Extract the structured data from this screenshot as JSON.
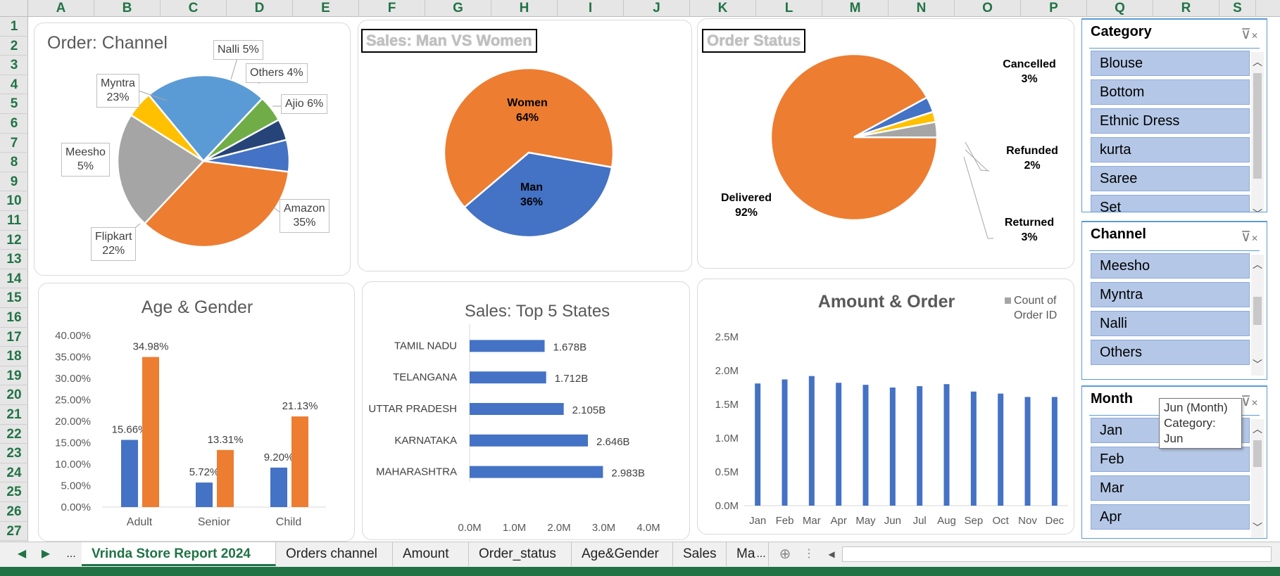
{
  "columns": [
    "A",
    "B",
    "C",
    "D",
    "E",
    "F",
    "G",
    "H",
    "I",
    "J",
    "K",
    "L",
    "M",
    "N",
    "O",
    "P",
    "Q",
    "R",
    "S"
  ],
  "rows": [
    "1",
    "2",
    "3",
    "4",
    "5",
    "6",
    "7",
    "8",
    "9",
    "10",
    "11",
    "12",
    "13",
    "14",
    "15",
    "16",
    "17",
    "18",
    "19",
    "20",
    "21",
    "22",
    "23",
    "24",
    "25",
    "26",
    "27"
  ],
  "colors": {
    "blue": "#4472c4",
    "orange": "#ed7d31",
    "gray": "#a5a5a5",
    "yellow": "#ffc000",
    "lightblue": "#5b9bd5",
    "green": "#70ad47",
    "navy": "#264478",
    "excel_green": "#217346"
  },
  "charts": {
    "order_channel": {
      "title": "Order: Channel",
      "chart_data": {
        "type": "pie",
        "slices": [
          {
            "name": "Amazon",
            "value": 35,
            "label": "35%",
            "color": "#ed7d31"
          },
          {
            "name": "Flipkart",
            "value": 22,
            "label": "22%",
            "color": "#a5a5a5"
          },
          {
            "name": "Meesho",
            "value": 5,
            "label": "5%",
            "color": "#ffc000"
          },
          {
            "name": "Myntra",
            "value": 23,
            "label": "23%",
            "color": "#5b9bd5"
          },
          {
            "name": "Nalli",
            "value": 5,
            "label": "5%",
            "color": "#70ad47"
          },
          {
            "name": "Others",
            "value": 4,
            "label": "4%",
            "color": "#264478"
          },
          {
            "name": "Ajio",
            "value": 6,
            "label": "6%",
            "color": "#4472c4"
          }
        ]
      },
      "labels": {
        "nalli": "Nalli 5%",
        "others": "Others 4%",
        "ajio": "Ajio 6%",
        "myntra_name": "Myntra",
        "myntra_pct": "23%",
        "meesho_name": "Meesho",
        "meesho_pct": "5%",
        "flipkart_name": "Flipkart",
        "flipkart_pct": "22%",
        "amazon_name": "Amazon",
        "amazon_pct": "35%"
      }
    },
    "man_women": {
      "title": "Sales: Man VS Women",
      "chart_data": {
        "type": "pie",
        "slices": [
          {
            "name": "Women",
            "value": 64,
            "label": "64%",
            "color": "#ed7d31"
          },
          {
            "name": "Man",
            "value": 36,
            "label": "36%",
            "color": "#4472c4"
          }
        ]
      },
      "labels": {
        "women_name": "Women",
        "women_pct": "64%",
        "man_name": "Man",
        "man_pct": "36%"
      }
    },
    "order_status": {
      "title": "Order Status",
      "chart_data": {
        "type": "pie",
        "slices": [
          {
            "name": "Delivered",
            "value": 92,
            "label": "92%",
            "color": "#ed7d31"
          },
          {
            "name": "Returned",
            "value": 3,
            "label": "3%",
            "color": "#4472c4"
          },
          {
            "name": "Refunded",
            "value": 2,
            "label": "2%",
            "color": "#ffc000"
          },
          {
            "name": "Cancelled",
            "value": 3,
            "label": "3%",
            "color": "#a5a5a5"
          }
        ]
      },
      "labels": {
        "cancelled_name": "Cancelled",
        "cancelled_pct": "3%",
        "refunded_name": "Refunded",
        "refunded_pct": "2%",
        "returned_name": "Returned",
        "returned_pct": "3%",
        "delivered_name": "Delivered",
        "delivered_pct": "92%"
      }
    },
    "age_gender": {
      "title": "Age & Gender",
      "chart_data": {
        "type": "bar",
        "categories": [
          "Adult",
          "Senior",
          "Child"
        ],
        "series": [
          {
            "values": [
              15.66,
              5.72,
              9.2
            ],
            "labels": [
              "15.66%",
              "5.72%",
              "9.20%"
            ],
            "color": "#4472c4"
          },
          {
            "values": [
              34.98,
              13.31,
              21.13
            ],
            "labels": [
              "34.98%",
              "13.31%",
              "21.13%"
            ],
            "color": "#ed7d31"
          }
        ],
        "ylim": [
          0,
          40
        ],
        "yticks": [
          "0.00%",
          "5.00%",
          "10.00%",
          "15.00%",
          "20.00%",
          "25.00%",
          "30.00%",
          "35.00%",
          "40.00%"
        ]
      }
    },
    "top_states": {
      "title": "Sales: Top 5 States",
      "chart_data": {
        "type": "bar",
        "orientation": "horizontal",
        "categories": [
          "TAMIL NADU",
          "TELANGANA",
          "UTTAR PRADESH",
          "KARNATAKA",
          "MAHARASHTRA"
        ],
        "values": [
          1.678,
          1.712,
          2.105,
          2.646,
          2.983
        ],
        "labels": [
          "1.678B",
          "1.712B",
          "2.105B",
          "2.646B",
          "2.983B"
        ],
        "xlim": [
          0,
          4
        ],
        "xticks": [
          "0.0M",
          "1.0M",
          "2.0M",
          "3.0M",
          "4.0M"
        ],
        "color": "#4472c4"
      }
    },
    "amount_order": {
      "title": "Amount & Order",
      "legend": "Count of Order ID",
      "legend_line1": "Count of",
      "legend_line2": "Order ID",
      "chart_data": {
        "type": "bar",
        "categories": [
          "Jan",
          "Feb",
          "Mar",
          "Apr",
          "May",
          "Jun",
          "Jul",
          "Aug",
          "Sep",
          "Oct",
          "Nov",
          "Dec"
        ],
        "series": [
          {
            "name": "Count of Order ID",
            "values": [
              1.81,
              1.87,
              1.92,
              1.82,
              1.79,
              1.75,
              1.77,
              1.8,
              1.69,
              1.66,
              1.61,
              1.61
            ]
          }
        ],
        "ylim": [
          0,
          2.5
        ],
        "yticks": [
          "0.0M",
          "0.5M",
          "1.0M",
          "1.5M",
          "2.0M",
          "2.5M"
        ],
        "color": "#4472c4"
      }
    }
  },
  "slicers": {
    "category": {
      "title": "Category",
      "items": [
        "Blouse",
        "Bottom",
        "Ethnic Dress",
        "kurta",
        "Saree",
        "Set"
      ]
    },
    "channel": {
      "title": "Channel",
      "items": [
        "Meesho",
        "Myntra",
        "Nalli",
        "Others"
      ]
    },
    "month": {
      "title": "Month",
      "items": [
        "Jan",
        "Feb",
        "Mar",
        "Apr"
      ]
    }
  },
  "tooltip": {
    "line1": "Jun (Month)",
    "line2": "Category: Jun"
  },
  "tabs": {
    "ellipsis": "...",
    "items": [
      "Vrinda Store Report  2024",
      "Orders channel",
      "Amount",
      "Order_status",
      "Age&Gender",
      "Sales",
      "Ma"
    ],
    "more": "..."
  }
}
